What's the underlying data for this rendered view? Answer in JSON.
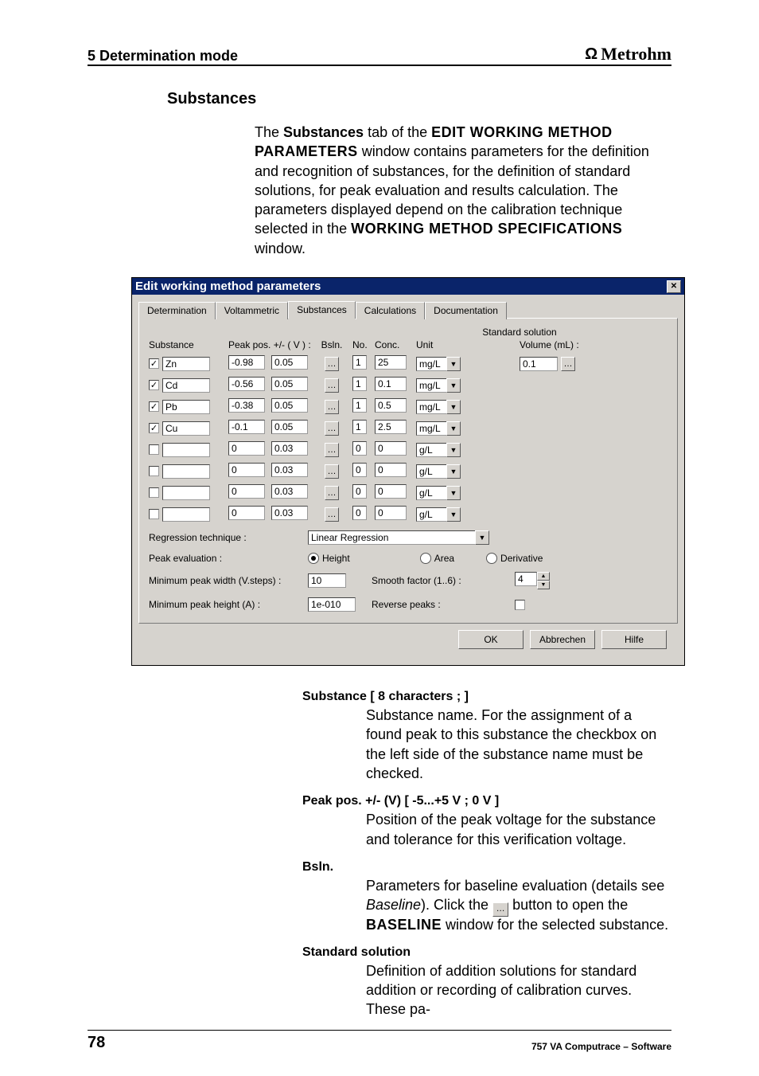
{
  "header": {
    "left": "5  Determination mode",
    "brand": "Metrohm"
  },
  "section_title": "Substances",
  "intro": {
    "line1_prefix": "The ",
    "substances": "Substances",
    "line1_mid": " tab of the ",
    "edit_win": "EDIT WORKING METHOD PARAMETERS",
    "body_middle": " window contains parameters for the definition and recognition of substances, for the definition of standard solutions, for peak evaluation and results calculation. The parameters displayed depend on the calibration technique selected in the ",
    "working": "WORKING METHOD SPECIFICATIONS",
    "tail": " window."
  },
  "dialog": {
    "title": "Edit working method parameters",
    "tabs": {
      "determination": "Determination",
      "voltammetric": "Voltammetric",
      "substances": "Substances",
      "calculations": "Calculations",
      "documentation": "Documentation"
    },
    "columns": {
      "substance": "Substance",
      "peak_pos": "Peak pos. +/- ( V ) :",
      "bsln": "Bsln.",
      "no": "No.",
      "conc": "Conc.",
      "unit": "Unit",
      "volume": "Volume (mL) :",
      "std_solution": "Standard solution"
    },
    "rows": [
      {
        "on": true,
        "name": "Zn",
        "pp": "-0.98",
        "tol": "0.05",
        "no": "1",
        "conc": "25",
        "unit": "mg/L"
      },
      {
        "on": true,
        "name": "Cd",
        "pp": "-0.56",
        "tol": "0.05",
        "no": "1",
        "conc": "0.1",
        "unit": "mg/L"
      },
      {
        "on": true,
        "name": "Pb",
        "pp": "-0.38",
        "tol": "0.05",
        "no": "1",
        "conc": "0.5",
        "unit": "mg/L"
      },
      {
        "on": true,
        "name": "Cu",
        "pp": "-0.1",
        "tol": "0.05",
        "no": "1",
        "conc": "2.5",
        "unit": "mg/L"
      },
      {
        "on": false,
        "name": "",
        "pp": "0",
        "tol": "0.03",
        "no": "0",
        "conc": "0",
        "unit": "g/L"
      },
      {
        "on": false,
        "name": "",
        "pp": "0",
        "tol": "0.03",
        "no": "0",
        "conc": "0",
        "unit": "g/L"
      },
      {
        "on": false,
        "name": "",
        "pp": "0",
        "tol": "0.03",
        "no": "0",
        "conc": "0",
        "unit": "g/L"
      },
      {
        "on": false,
        "name": "",
        "pp": "0",
        "tol": "0.03",
        "no": "0",
        "conc": "0",
        "unit": "g/L"
      }
    ],
    "volume_value": "0.1",
    "regression": {
      "label": "Regression technique :",
      "value": "Linear Regression"
    },
    "peak_eval": {
      "label": "Peak evaluation :",
      "height": "Height",
      "area": "Area",
      "derivative": "Derivative"
    },
    "min_width": {
      "label": "Minimum peak width (V.steps) :",
      "value": "10"
    },
    "smooth": {
      "label": "Smooth factor (1..6) :",
      "value": "4"
    },
    "min_height": {
      "label": "Minimum peak height (A) :",
      "value": "1e-010"
    },
    "reverse": {
      "label": "Reverse peaks :"
    },
    "buttons": {
      "ok": "OK",
      "cancel": "Abbrechen",
      "help": "Hilfe"
    }
  },
  "defs": {
    "substance": {
      "title": "Substance   [ 8 characters ; ]",
      "body": "Substance name. For the assignment of a found peak to this substance the checkbox on the left side of the substance name must be checked."
    },
    "peakpos": {
      "title": "Peak pos. +/- (V)   [ -5...+5 V ; 0 V ]",
      "body": "Position of the peak voltage for the substance and tolerance for this verification voltage."
    },
    "bsln": {
      "title": "Bsln.",
      "pre": "Parameters for baseline evaluation (details see ",
      "italic": "Baseline",
      "mid": "). Click the ",
      "after": " button to open the ",
      "baseline_win": "BASELINE",
      "tail": " window for the selected substance."
    },
    "std": {
      "title": "Standard solution",
      "body": "Definition of addition solutions for standard addition or recording of calibration curves. These pa-"
    }
  },
  "footer": {
    "page": "78",
    "right": "757 VA Computrace – Software"
  }
}
